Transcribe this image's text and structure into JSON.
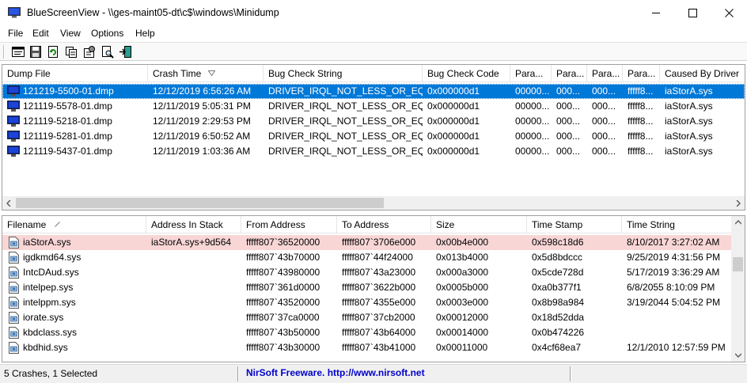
{
  "window": {
    "title": "BlueScreenView  -  \\\\ges-maint05-dt\\c$\\windows\\Minidump",
    "controls": [
      "minimize",
      "maximize",
      "close"
    ]
  },
  "menu": [
    "File",
    "Edit",
    "View",
    "Options",
    "Help"
  ],
  "toolbar": {
    "buttons": [
      "properties-icon",
      "save-icon",
      "refresh-icon",
      "copy-icon",
      "advanced-options-icon",
      "find-icon",
      "exit-icon"
    ]
  },
  "crash_list": {
    "columns": [
      "Dump File",
      "Crash Time",
      "Bug Check String",
      "Bug Check Code",
      "Para...",
      "Para...",
      "Para...",
      "Para...",
      "Caused By Driver"
    ],
    "sorted_column": "Crash Time",
    "rows": [
      {
        "dump_file": "121219-5500-01.dmp",
        "crash_time": "12/12/2019 6:56:26 AM",
        "bug_check_string": "DRIVER_IRQL_NOT_LESS_OR_EQUAL",
        "bug_check_code": "0x000000d1",
        "p1": "00000...",
        "p2": "000...",
        "p3": "000...",
        "p4": "fffff8...",
        "caused_by": "iaStorA.sys",
        "selected": true
      },
      {
        "dump_file": "121119-5578-01.dmp",
        "crash_time": "12/11/2019 5:05:31 PM",
        "bug_check_string": "DRIVER_IRQL_NOT_LESS_OR_EQUAL",
        "bug_check_code": "0x000000d1",
        "p1": "00000...",
        "p2": "000...",
        "p3": "000...",
        "p4": "fffff8...",
        "caused_by": "iaStorA.sys",
        "selected": false
      },
      {
        "dump_file": "121119-5218-01.dmp",
        "crash_time": "12/11/2019 2:29:53 PM",
        "bug_check_string": "DRIVER_IRQL_NOT_LESS_OR_EQUAL",
        "bug_check_code": "0x000000d1",
        "p1": "00000...",
        "p2": "000...",
        "p3": "000...",
        "p4": "fffff8...",
        "caused_by": "iaStorA.sys",
        "selected": false
      },
      {
        "dump_file": "121119-5281-01.dmp",
        "crash_time": "12/11/2019 6:50:52 AM",
        "bug_check_string": "DRIVER_IRQL_NOT_LESS_OR_EQUAL",
        "bug_check_code": "0x000000d1",
        "p1": "00000...",
        "p2": "000...",
        "p3": "000...",
        "p4": "fffff8...",
        "caused_by": "iaStorA.sys",
        "selected": false
      },
      {
        "dump_file": "121119-5437-01.dmp",
        "crash_time": "12/11/2019 1:03:36 AM",
        "bug_check_string": "DRIVER_IRQL_NOT_LESS_OR_EQUAL",
        "bug_check_code": "0x000000d1",
        "p1": "00000...",
        "p2": "000...",
        "p3": "000...",
        "p4": "fffff8...",
        "caused_by": "iaStorA.sys",
        "selected": false
      }
    ]
  },
  "driver_list": {
    "columns": [
      "Filename",
      "Address In Stack",
      "From Address",
      "To Address",
      "Size",
      "Time Stamp",
      "Time String"
    ],
    "sorted_column": "Filename",
    "rows": [
      {
        "filename": "iaStorA.sys",
        "address_in_stack": "iaStorA.sys+9d564",
        "from": "fffff807`36520000",
        "to": "fffff807`3706e000",
        "size": "0x00b4e000",
        "time_stamp": "0x598c18d6",
        "time_string": "8/10/2017 3:27:02 AM",
        "highlight": true
      },
      {
        "filename": "igdkmd64.sys",
        "address_in_stack": "",
        "from": "fffff807`43b70000",
        "to": "fffff807`44f24000",
        "size": "0x013b4000",
        "time_stamp": "0x5d8bdccc",
        "time_string": "9/25/2019 4:31:56 PM",
        "highlight": false
      },
      {
        "filename": "IntcDAud.sys",
        "address_in_stack": "",
        "from": "fffff807`43980000",
        "to": "fffff807`43a23000",
        "size": "0x000a3000",
        "time_stamp": "0x5cde728d",
        "time_string": "5/17/2019 3:36:29 AM",
        "highlight": false
      },
      {
        "filename": "intelpep.sys",
        "address_in_stack": "",
        "from": "fffff807`361d0000",
        "to": "fffff807`3622b000",
        "size": "0x0005b000",
        "time_stamp": "0xa0b377f1",
        "time_string": "6/8/2055 8:10:09 PM",
        "highlight": false
      },
      {
        "filename": "intelppm.sys",
        "address_in_stack": "",
        "from": "fffff807`43520000",
        "to": "fffff807`4355e000",
        "size": "0x0003e000",
        "time_stamp": "0x8b98a984",
        "time_string": "3/19/2044 5:04:52 PM",
        "highlight": false
      },
      {
        "filename": "iorate.sys",
        "address_in_stack": "",
        "from": "fffff807`37ca0000",
        "to": "fffff807`37cb2000",
        "size": "0x00012000",
        "time_stamp": "0x18d52dda",
        "time_string": "",
        "highlight": false
      },
      {
        "filename": "kbdclass.sys",
        "address_in_stack": "",
        "from": "fffff807`43b50000",
        "to": "fffff807`43b64000",
        "size": "0x00014000",
        "time_stamp": "0x0b474226",
        "time_string": "",
        "highlight": false
      },
      {
        "filename": "kbdhid.sys",
        "address_in_stack": "",
        "from": "fffff807`43b30000",
        "to": "fffff807`43b41000",
        "size": "0x00011000",
        "time_stamp": "0x4cf68ea7",
        "time_string": "12/1/2010 12:57:59 PM",
        "highlight": false
      }
    ]
  },
  "status": {
    "summary": "5 Crashes, 1 Selected",
    "link": "NirSoft Freeware.  http://www.nirsoft.net"
  },
  "colors": {
    "selection": "#0078d7",
    "highlight_row": "#f9d6d6",
    "link": "#0000cc"
  }
}
